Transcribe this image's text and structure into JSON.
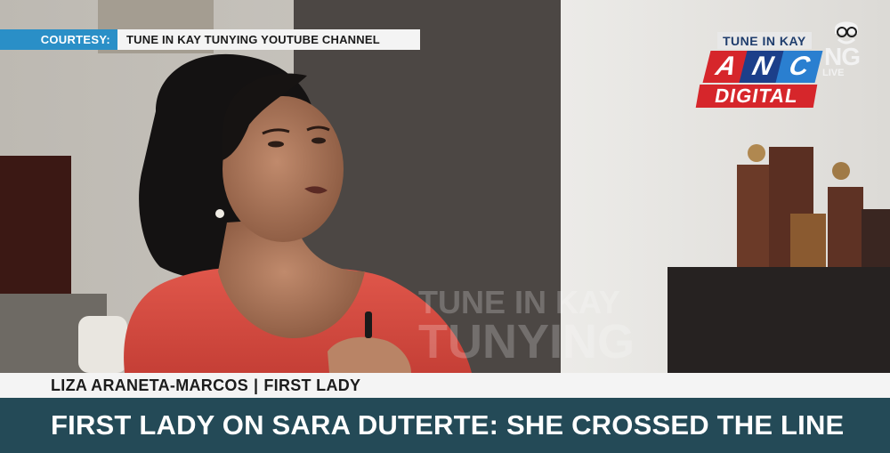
{
  "courtesy": {
    "label": "COURTESY:",
    "source": "TUNE IN KAY TUNYING YOUTUBE CHANNEL"
  },
  "logo": {
    "tune_in_kay": "TUNE IN KAY",
    "anc_letters": [
      "A",
      "N",
      "C"
    ],
    "ng": "NG",
    "live": "LIVE",
    "digital": "DIGITAL",
    "icon": "cartoon-face-icon"
  },
  "lower_third": {
    "name": "LIZA ARANETA-MARCOS",
    "separator": "|",
    "title": "FIRST LADY",
    "headline": "FIRST LADY ON SARA DUTERTE: SHE CROSSED THE LINE"
  },
  "watermark": {
    "line1": "TUNE IN KAY",
    "line2": "TUNYING"
  }
}
